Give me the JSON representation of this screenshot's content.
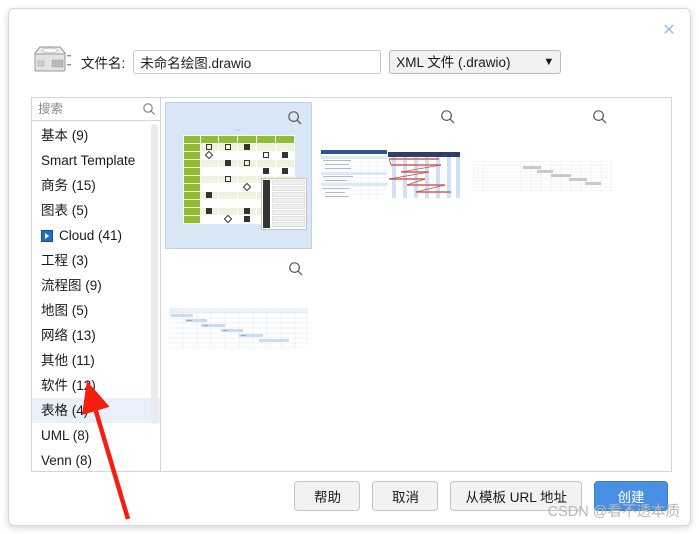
{
  "dialog": {
    "close_icon": "close-icon",
    "drive_icon": "hard-drive-icon"
  },
  "filename": {
    "label": "文件名:",
    "value": "未命名绘图.drawio",
    "placeholder": "未命名绘图.drawio"
  },
  "format": {
    "selected": "XML 文件 (.drawio)",
    "options": [
      "XML 文件 (.drawio)"
    ],
    "chevron_icon": "chevron-down-icon"
  },
  "search": {
    "placeholder": "搜索",
    "value": "",
    "icon": "search-icon"
  },
  "categories": [
    {
      "label": "基本 (9)",
      "selected": false,
      "icon": null
    },
    {
      "label": "Smart Template",
      "selected": false,
      "icon": null
    },
    {
      "label": "商务 (15)",
      "selected": false,
      "icon": null
    },
    {
      "label": "图表 (5)",
      "selected": false,
      "icon": null
    },
    {
      "label": "Cloud (41)",
      "selected": false,
      "icon": "expand-arrow-icon"
    },
    {
      "label": "工程 (3)",
      "selected": false,
      "icon": null
    },
    {
      "label": "流程图 (9)",
      "selected": false,
      "icon": null
    },
    {
      "label": "地图 (5)",
      "selected": false,
      "icon": null
    },
    {
      "label": "网络 (13)",
      "selected": false,
      "icon": null
    },
    {
      "label": "其他 (11)",
      "selected": false,
      "icon": null
    },
    {
      "label": "软件 (12)",
      "selected": false,
      "icon": null
    },
    {
      "label": "表格 (4)",
      "selected": true,
      "icon": null
    },
    {
      "label": "UML (8)",
      "selected": false,
      "icon": null
    },
    {
      "label": "Venn (8)",
      "selected": false,
      "icon": null
    }
  ],
  "templates": [
    {
      "name": "template-green-table",
      "selected": true,
      "zoom_icon": "magnifier-icon"
    },
    {
      "name": "template-gantt-detailed",
      "selected": false,
      "zoom_icon": "magnifier-icon"
    },
    {
      "name": "template-gantt-simple",
      "selected": false,
      "zoom_icon": "magnifier-icon"
    },
    {
      "name": "template-gantt-blue",
      "selected": false,
      "zoom_icon": "magnifier-icon"
    }
  ],
  "footer": {
    "help_label": "帮助",
    "cancel_label": "取消",
    "url_label": "从模板 URL 地址",
    "create_label": "创建"
  },
  "watermark": "CSDN @看不透本质",
  "colors": {
    "accent": "#4a90e2",
    "selection": "#d9e6f6",
    "sidebar_selection": "#e8f0fa",
    "table_green": "#8fbc31",
    "annotation_red": "#f41f10"
  },
  "annotation": {
    "type": "arrow",
    "points_to": "表格 (4)"
  }
}
